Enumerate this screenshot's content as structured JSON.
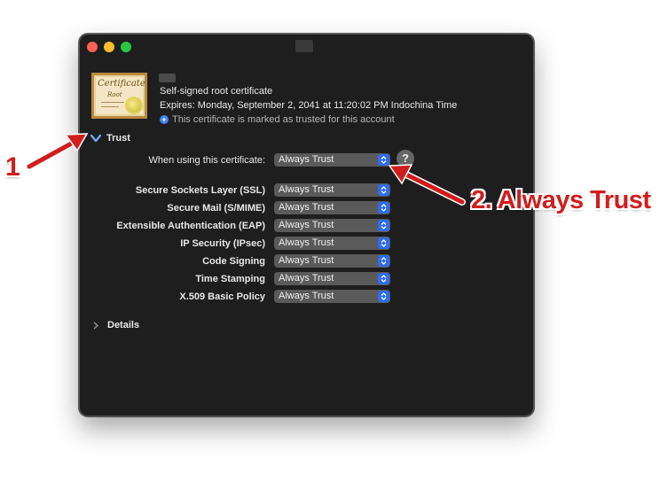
{
  "window": {
    "title": ""
  },
  "certificate": {
    "icon_text": "Certificate",
    "icon_subtext": "Root",
    "type": "Self-signed root certificate",
    "expires": "Expires: Monday, September 2, 2041 at 11:20:02 PM Indochina Time",
    "trust_status": "This certificate is marked as trusted for this account"
  },
  "trust_section": {
    "label": "Trust",
    "when_using_label": "When using this certificate:",
    "when_using_value": "Always Trust",
    "rows": [
      {
        "label": "Secure Sockets Layer (SSL)",
        "value": "Always Trust"
      },
      {
        "label": "Secure Mail (S/MIME)",
        "value": "Always Trust"
      },
      {
        "label": "Extensible Authentication (EAP)",
        "value": "Always Trust"
      },
      {
        "label": "IP Security (IPsec)",
        "value": "Always Trust"
      },
      {
        "label": "Code Signing",
        "value": "Always Trust"
      },
      {
        "label": "Time Stamping",
        "value": "Always Trust"
      },
      {
        "label": "X.509 Basic Policy",
        "value": "Always Trust"
      }
    ],
    "help_label": "?"
  },
  "details_section": {
    "label": "Details"
  },
  "annotations": {
    "step1": "1",
    "step2": "2. Always Trust",
    "color": "#d11d1d"
  }
}
